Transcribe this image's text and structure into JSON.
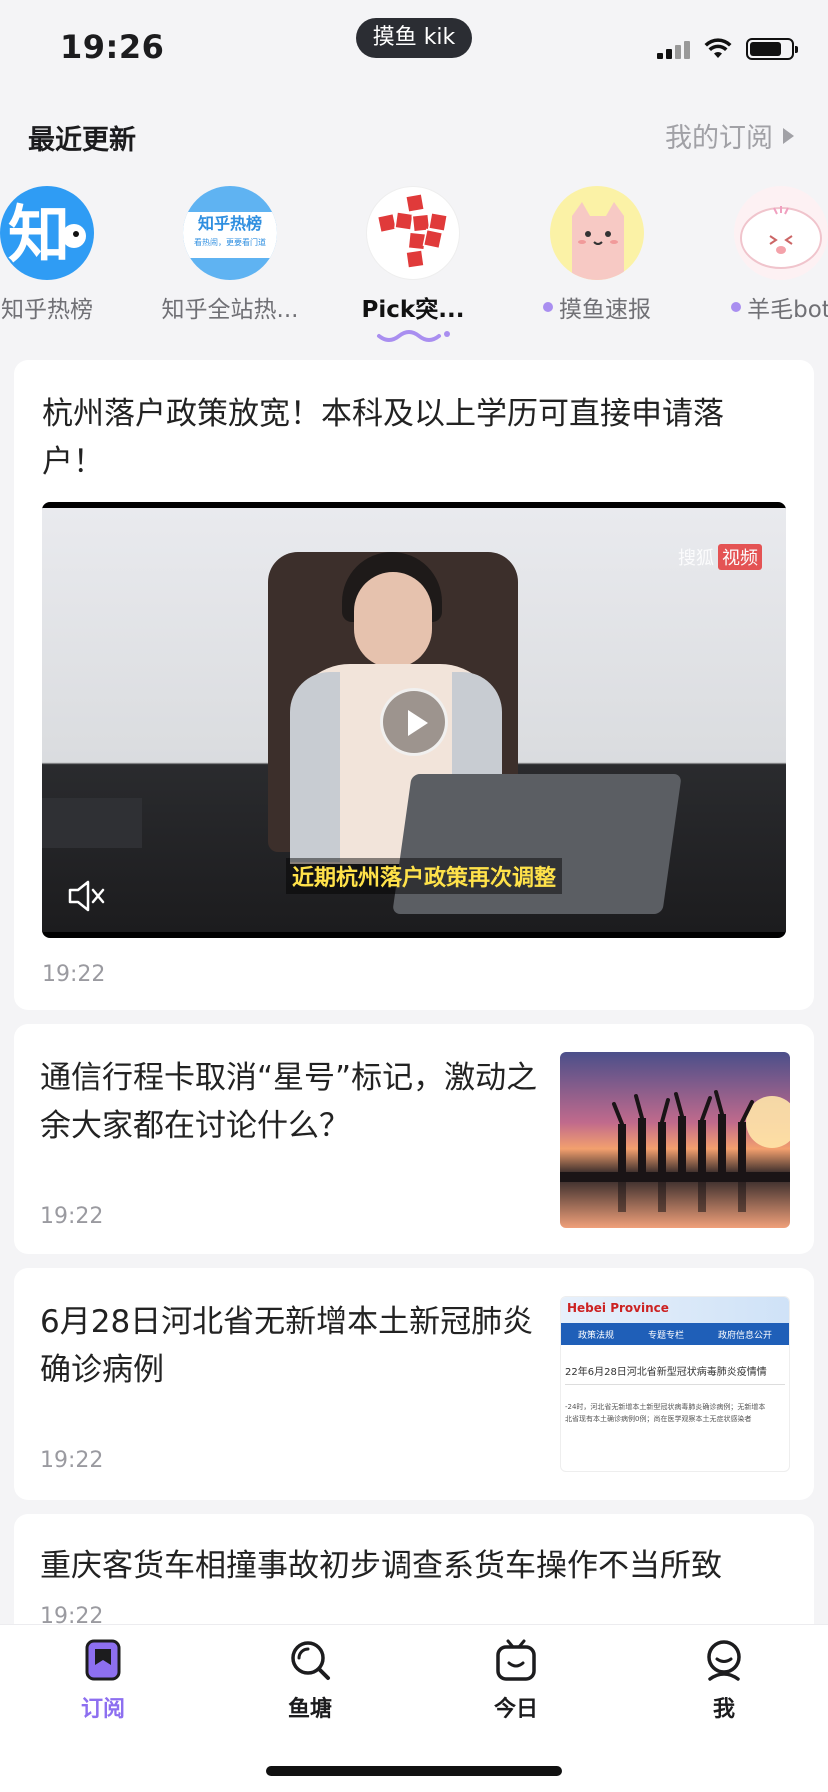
{
  "status_bar": {
    "time": "19:26",
    "pill": "摸鱼 kik"
  },
  "header": {
    "title": "最近更新",
    "subscriptions_link": "我的订阅"
  },
  "channels": [
    {
      "label": "知乎热榜",
      "icon": "zhihu-icon",
      "dot": false,
      "active": false
    },
    {
      "label": "知乎全站热...",
      "icon": "zhihu-hot-icon",
      "dot": false,
      "active": false,
      "badge_title": "知乎热榜",
      "badge_sub": "看热闹，更要看门道"
    },
    {
      "label": "Pick突...",
      "icon": "news-icon",
      "dot": false,
      "active": true
    },
    {
      "label": "摸鱼速报",
      "icon": "cat-icon",
      "dot": true,
      "active": false
    },
    {
      "label": "羊毛bot",
      "icon": "sheep-icon",
      "dot": true,
      "active": false
    }
  ],
  "feed": [
    {
      "type": "video",
      "title": "杭州落户政策放宽！本科及以上学历可直接申请落户！",
      "time": "19:22",
      "subtitle": "近期杭州落户政策再次调整",
      "watermark_a": "搜狐",
      "watermark_b": "视频"
    },
    {
      "type": "article",
      "title": "通信行程卡取消“星号”标记，激动之余大家都在讨论什么？",
      "time": "19:22",
      "thumb": "sunset-group-image"
    },
    {
      "type": "article",
      "title": "6月28日河北省无新增本土新冠肺炎确诊病例",
      "time": "19:22",
      "thumb": "hebei-document-image",
      "thumb_header": "Hebei Province",
      "thumb_nav": [
        "政策法规",
        "专题专栏",
        "政府信息公开"
      ],
      "thumb_heading": "22年6月28日河北省新型冠状病毒肺炎疫情情",
      "thumb_lines": [
        "-24时，河北省无新增本土新型冠状病毒肺炎确诊病例；无新增本",
        "北省现有本土确诊病例0例；尚在医学观察本土无症状感染者"
      ]
    },
    {
      "type": "article",
      "title": "重庆客货车相撞事故初步调查系货车操作不当所致",
      "time": "19:22"
    }
  ],
  "tabs": [
    {
      "label": "订阅",
      "icon": "bookmark-icon",
      "active": true
    },
    {
      "label": "鱼塘",
      "icon": "search-icon",
      "active": false
    },
    {
      "label": "今日",
      "icon": "tv-icon",
      "active": false
    },
    {
      "label": "我",
      "icon": "profile-icon",
      "active": false
    }
  ],
  "colors": {
    "accent": "#8d6ff0",
    "muted": "#a1a1a6",
    "dot": "#a98ef0"
  }
}
